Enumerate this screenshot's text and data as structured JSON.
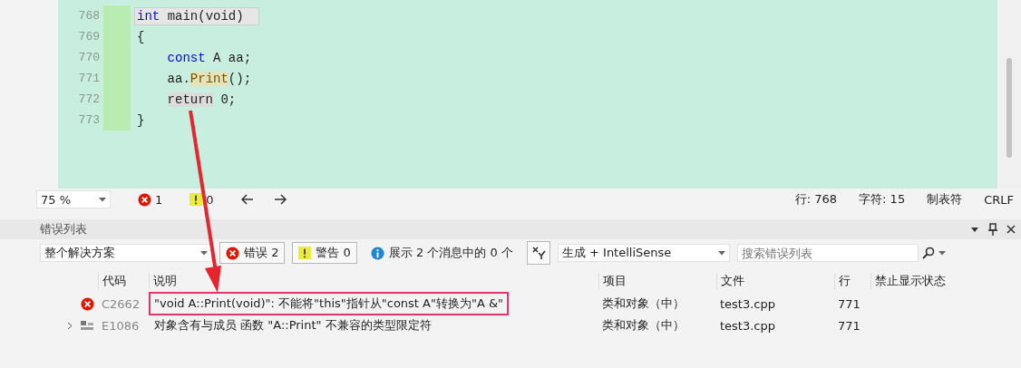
{
  "editor": {
    "lines": [
      {
        "number": "768",
        "current": true,
        "tokens": [
          {
            "text": "int",
            "kind": "keyword"
          },
          {
            "text": " main(void)",
            "kind": "plain"
          }
        ]
      },
      {
        "number": "769",
        "current": false,
        "tokens": [
          {
            "text": "{",
            "kind": "plain"
          }
        ]
      },
      {
        "number": "770",
        "current": false,
        "tokens": [
          {
            "text": "    const",
            "kind": "keyword"
          },
          {
            "text": " A aa;",
            "kind": "plain"
          }
        ]
      },
      {
        "number": "771",
        "current": false,
        "tokens": [
          {
            "text": "    aa.",
            "kind": "plain"
          },
          {
            "text": "Print",
            "kind": "reference"
          },
          {
            "text": "();",
            "kind": "plain"
          }
        ]
      },
      {
        "number": "772",
        "current": false,
        "tokens": [
          {
            "text": "    return",
            "kind": "match"
          },
          {
            "text": " 0;",
            "kind": "plain"
          }
        ]
      },
      {
        "number": "773",
        "current": false,
        "tokens": [
          {
            "text": "}",
            "kind": "plain"
          }
        ]
      }
    ]
  },
  "status_bar": {
    "zoom": "75 %",
    "errors": "1",
    "warnings": "0",
    "line": "行: 768",
    "column": "字符: 15",
    "indent": "制表符",
    "eol": "CRLF"
  },
  "error_list": {
    "title": "错误列表",
    "scope": "整个解决方案",
    "filters": [
      {
        "kind": "error",
        "label": "错误 2",
        "selected": true
      },
      {
        "kind": "warning",
        "label": "警告 0",
        "selected": true
      },
      {
        "kind": "info",
        "label": "展示 2 个消息中的 0 个",
        "selected": false
      }
    ],
    "source": "生成 + IntelliSense",
    "search": {
      "placeholder": "搜索错误列表"
    },
    "columns": [
      "代码",
      "说明",
      "项目",
      "文件",
      "行",
      "禁止显示状态"
    ],
    "rows": [
      {
        "kind": "error",
        "expandable": false,
        "highlighted": true,
        "code": "C2662",
        "description": "\"void A::Print(void)\": 不能将\"this\"指针从\"const A\"转换为\"A &\"",
        "project": "类和对象（中）",
        "file": "test3.cpp",
        "line": "771"
      },
      {
        "kind": "intellisense",
        "expandable": true,
        "highlighted": false,
        "code": "E1086",
        "description": "对象含有与成员 函数 \"A::Print\" 不兼容的类型限定符",
        "project": "类和对象（中）",
        "file": "test3.cpp",
        "line": "771"
      }
    ]
  }
}
